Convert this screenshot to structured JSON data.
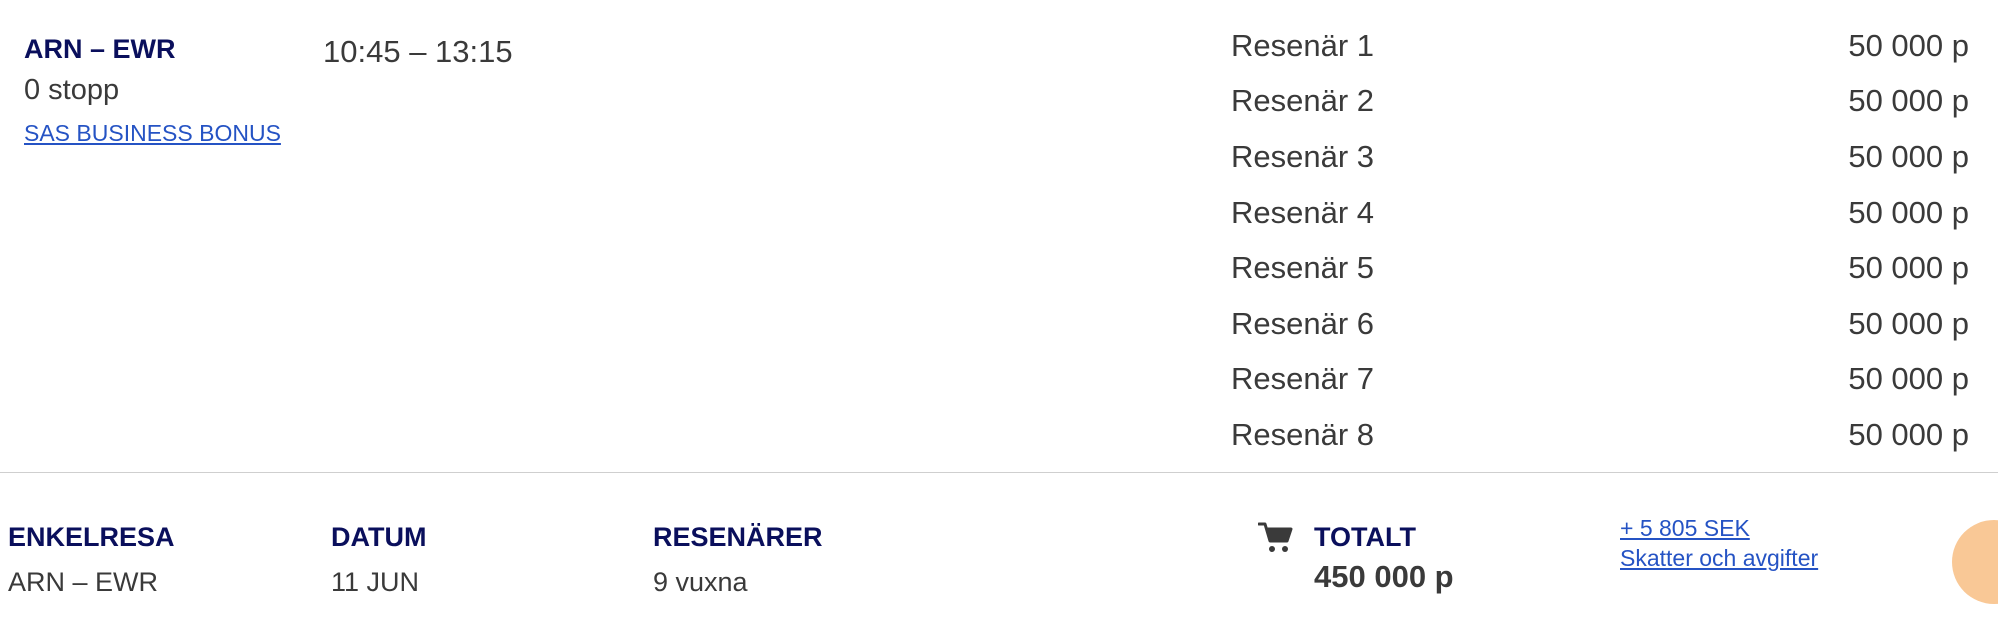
{
  "flight": {
    "route": "ARN – EWR",
    "stops": "0 stopp",
    "fare_link": "SAS BUSINESS BONUS",
    "times": "10:45 – 13:15"
  },
  "passengers": [
    {
      "label": "Resenär 1",
      "price": "50 000 p"
    },
    {
      "label": "Resenär 2",
      "price": "50 000 p"
    },
    {
      "label": "Resenär 3",
      "price": "50 000 p"
    },
    {
      "label": "Resenär 4",
      "price": "50 000 p"
    },
    {
      "label": "Resenär 5",
      "price": "50 000 p"
    },
    {
      "label": "Resenär 6",
      "price": "50 000 p"
    },
    {
      "label": "Resenär 7",
      "price": "50 000 p"
    },
    {
      "label": "Resenär 8",
      "price": "50 000 p"
    }
  ],
  "summary": {
    "trip_type_label": "ENKELRESA",
    "trip_route": "ARN – EWR",
    "date_label": "DATUM",
    "date_value": "11 JUN",
    "travelers_label": "RESENÄRER",
    "travelers_value": "9 vuxna",
    "total_label": "TOTALT",
    "total_value": "450 000 p",
    "tax_amount": "+ 5 805 SEK",
    "tax_label": "Skatter och avgifter",
    "cart_icon": "shopping-cart-icon"
  },
  "colors": {
    "heading_navy": "#0a0f5c",
    "link_blue": "#2553c4",
    "text_gray": "#3a3a3a",
    "fab_peach": "#f9c896",
    "divider": "#cfcfcf"
  }
}
